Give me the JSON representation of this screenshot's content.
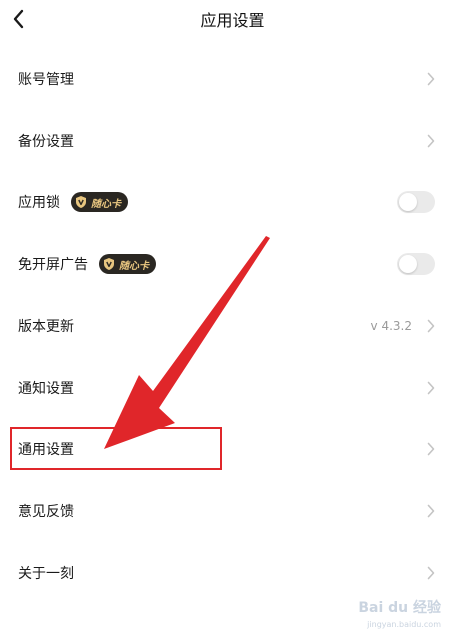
{
  "header": {
    "title": "应用设置",
    "back_icon": "back-arrow-icon"
  },
  "rows": [
    {
      "label": "账号管理",
      "control": "chevron"
    },
    {
      "label": "备份设置",
      "control": "chevron"
    },
    {
      "label": "应用锁",
      "control": "toggle",
      "toggle_on": false,
      "badge": "随心卡"
    },
    {
      "label": "免开屏广告",
      "control": "toggle",
      "toggle_on": false,
      "badge": "随心卡"
    },
    {
      "label": "版本更新",
      "control": "chevron",
      "value": "v 4.3.2"
    },
    {
      "label": "通知设置",
      "control": "chevron"
    },
    {
      "label": "通用设置",
      "control": "chevron",
      "highlighted": true
    },
    {
      "label": "意见反馈",
      "control": "chevron"
    },
    {
      "label": "关于一刻",
      "control": "chevron"
    }
  ],
  "annotation": {
    "color": "#e0262a",
    "target": "通用设置"
  },
  "badge_colors": {
    "background": "#2a2722",
    "text": "#e8c680"
  },
  "watermark": {
    "text": "Bai du 经验",
    "sub": "jingyan.baidu.com"
  }
}
